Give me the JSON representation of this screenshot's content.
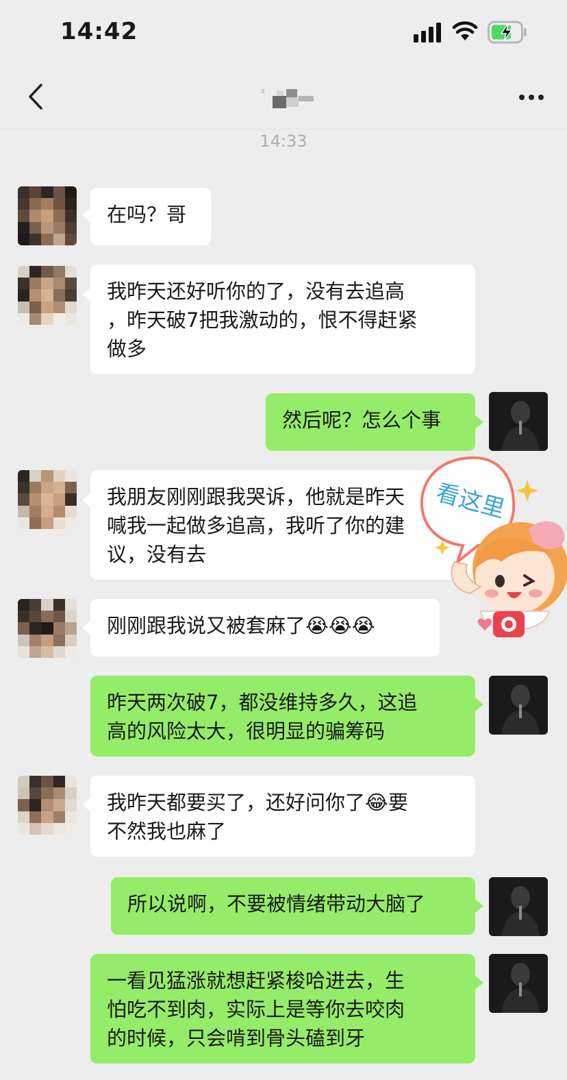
{
  "status_bar": {
    "time": "14:42"
  },
  "nav": {
    "title": "",
    "back_icon": "chevron-left-icon",
    "more_icon": "more-horizontal-icon"
  },
  "timestamp": "14:33",
  "messages": [
    {
      "from": "contact",
      "text": "在吗？哥"
    },
    {
      "from": "contact",
      "text": "我昨天还好听你的了，没有去追高\n，昨天破7把我激动的，恨不得赶紧\n做多"
    },
    {
      "from": "me",
      "text": "然后呢？怎么个事"
    },
    {
      "from": "contact",
      "text": "我朋友刚刚跟我哭诉，他就是昨天\n喊我一起做多追高，我听了你的建\n议，没有去"
    },
    {
      "from": "contact",
      "text": "刚刚跟我说又被套麻了😭😭😭"
    },
    {
      "from": "me",
      "text": "昨天两次破7，都没维持多久，这追\n高的风险太大，很明显的骗筹码"
    },
    {
      "from": "contact",
      "text": "我昨天都要买了，还好问你了😂要\n不然我也麻了"
    },
    {
      "from": "me",
      "text": "所以说啊，不要被情绪带动大脑了"
    },
    {
      "from": "me",
      "text": "一看见猛涨就想赶紧梭哈进去，生\n怕吃不到肉，实际上是等你去咬肉\n的时候，只会啃到骨头磕到牙"
    }
  ],
  "sticker": {
    "text": "看这里",
    "icon": "cartoon-girl-camera-sticker"
  },
  "colors": {
    "background": "#ededed",
    "incoming_bubble": "#ffffff",
    "outgoing_bubble": "#95ec69",
    "timestamp": "#aeaeae"
  }
}
